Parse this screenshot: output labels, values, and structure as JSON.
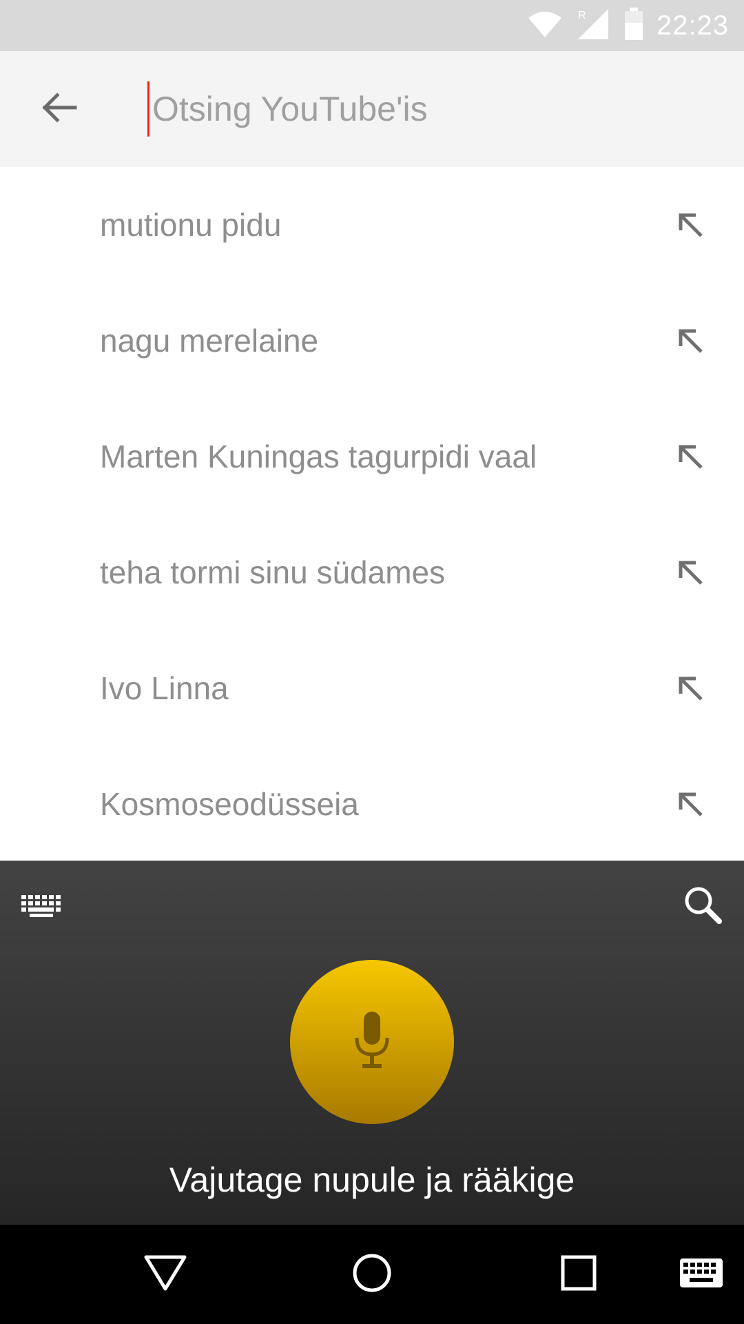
{
  "status_bar": {
    "time": "22:23",
    "icons": [
      "wifi-icon",
      "signal-roaming-icon",
      "battery-icon"
    ]
  },
  "search": {
    "placeholder": "Otsing YouTube'is",
    "value": "",
    "back_icon": "arrow-back-icon",
    "accent_color": "#e62117"
  },
  "suggestions": [
    {
      "text": "mutionu pidu"
    },
    {
      "text": "nagu merelaine"
    },
    {
      "text": "Marten Kuningas tagurpidi vaal"
    },
    {
      "text": "teha tormi sinu südames"
    },
    {
      "text": "Ivo Linna"
    },
    {
      "text": "Kosmoseodüsseia"
    }
  ],
  "voice_panel": {
    "hint": "Vajutage nupule ja rääkige",
    "mic_color": "#f7c700",
    "left_icon": "keyboard-icon",
    "right_icon": "search-icon"
  },
  "nav_bar": {
    "buttons": [
      "back-triangle-icon",
      "home-circle-icon",
      "recents-square-icon",
      "keyboard-switch-icon"
    ]
  }
}
